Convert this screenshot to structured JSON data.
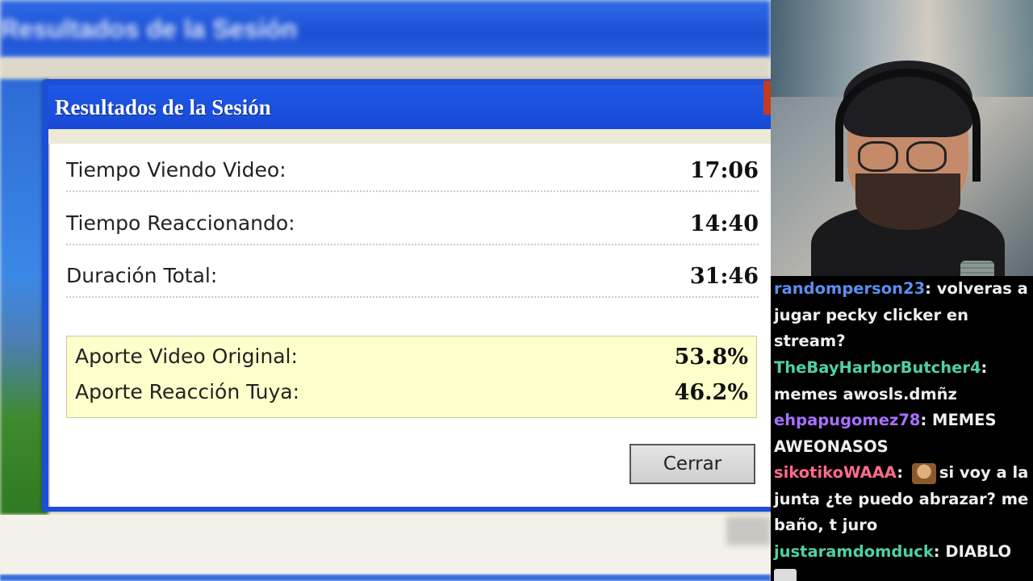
{
  "dialog": {
    "title": "Resultados de la Sesión",
    "rows": [
      {
        "label": "Tiempo Viendo Video:",
        "value": "17:06"
      },
      {
        "label": "Tiempo Reaccionando:",
        "value": "14:40"
      },
      {
        "label": "Duración Total:",
        "value": "31:46"
      }
    ],
    "shares": [
      {
        "label": "Aporte Video Original:",
        "value": "53.8%"
      },
      {
        "label": "Aporte Reacción Tuya:",
        "value": "46.2%"
      }
    ],
    "close_label": "Cerrar"
  },
  "background": {
    "window_title": "Resultados de la Sesión"
  },
  "chat": {
    "messages": [
      {
        "user": "randomperson23",
        "color": "#5b8ff0",
        "text": "volveras a jugar pecky clicker en stream?"
      },
      {
        "user": "TheBayHarborButcher4",
        "color": "#4fd1a3",
        "text": "memes awosls.dmñz"
      },
      {
        "user": "ehpapugomez78",
        "color": "#a970ff",
        "text": "MEMES AWEONASOS"
      },
      {
        "user": "sikotikoWAAA",
        "color": "#ff6b8a",
        "text": "si voy a la junta ¿te puedo abrazar? me baño, t juro",
        "emote": "person-emote"
      },
      {
        "user": "justaramdomduck",
        "color": "#4fd1a3",
        "text": "DIABLO"
      }
    ]
  },
  "colors": {
    "xp_blue": "#1c4fd8",
    "share_bg": "#ffffcc",
    "chat_bg": "#000000"
  }
}
